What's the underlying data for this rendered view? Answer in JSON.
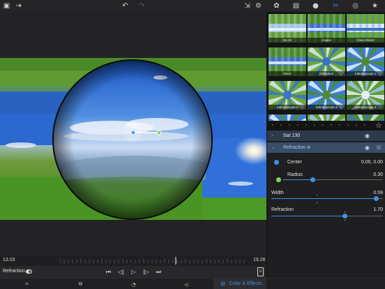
{
  "toolbar": {
    "left_icons": [
      "photo-library-icon",
      "import-icon"
    ],
    "center_icons": [
      "undo-icon",
      "redo-icon"
    ],
    "right_icons": [
      "export-share-icon",
      "settings-gear-icon",
      "palette-icon",
      "gradient-icon",
      "droplet-icon",
      "effects-icon",
      "target-icon",
      "star-icon"
    ]
  },
  "viewer": {
    "effect": "Refraction",
    "handle_color": "#7ed957"
  },
  "timeline": {
    "start_time": "13.03",
    "end_time": "19.26"
  },
  "transport": {
    "layer_label": "Refraction",
    "toggle_on": true,
    "buttons": [
      "skip-to-start-icon",
      "step-back-icon",
      "play-icon",
      "step-forward-icon",
      "skip-to-end-icon"
    ]
  },
  "tabbar": {
    "icons": [
      "adjust-icon",
      "crop-icon",
      "speed-icon",
      "audio-icon"
    ],
    "active_tab": "Color & Effects",
    "accent": "#3d93e6"
  },
  "library": {
    "rows": [
      [
        {
          "label": "Op Art"
        },
        {
          "label": "Angles"
        },
        {
          "label": "Glass Distort"
        }
      ],
      [
        {
          "label": "Mirror"
        },
        {
          "label": "Refraction"
        },
        {
          "label": "Kaleidoscope 1"
        }
      ],
      [
        {
          "label": "Kaleidoscope 2"
        },
        {
          "label": "Kaleidoscope 3"
        },
        {
          "label": "Kaleidoscope 4"
        }
      ],
      [
        {
          "label": ""
        },
        {
          "label": ""
        },
        {
          "label": ""
        }
      ]
    ]
  },
  "layers": [
    {
      "name": "Sat 130",
      "selected": false
    },
    {
      "name": "Refraction",
      "selected": true,
      "suffix": "⚙"
    }
  ],
  "params": {
    "center": {
      "label": "Center",
      "value": "0.00, 0.00"
    },
    "radius": {
      "label": "Radius",
      "value": "0.30",
      "fraction": 0.3
    },
    "width": {
      "label": "Width",
      "value": "0.59",
      "fraction": 0.94
    },
    "refraction": {
      "label": "Refraction",
      "value": "1.70",
      "fraction": 0.66
    }
  }
}
